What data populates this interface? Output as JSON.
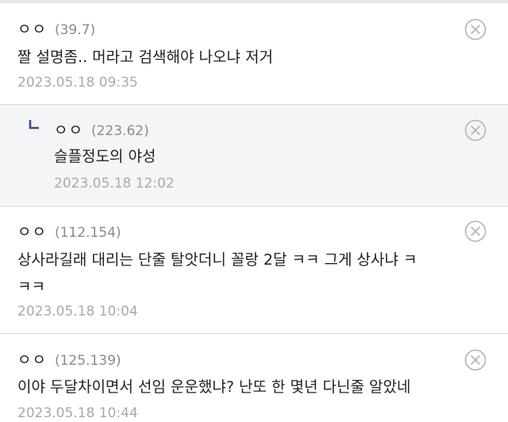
{
  "comments": [
    {
      "nick": "ㅇㅇ",
      "ip": "(39.7)",
      "text": "짤 설명좀.. 머라고 검색해야 나오냐 저거",
      "date": "2023.05.18 09:35"
    },
    {
      "nick": "ㅇㅇ",
      "ip": "(223.62)",
      "text": "슬플정도의 야성",
      "date": "2023.05.18 12:02"
    },
    {
      "nick": "ㅇㅇ",
      "ip": "(112.154)",
      "text_line1": "상사라길래 대리는 단줄 탈앗더니 꼴랑 2달 ㅋㅋ 그게 상사냐 ㅋ",
      "text_line2": "ㅋㅋ",
      "date": "2023.05.18 10:04"
    },
    {
      "nick": "ㅇㅇ",
      "ip": "(125.139)",
      "text": "이야 두달차이면서 선임 운운했냐? 난또 한 몇년 다닌줄 알았네",
      "date": "2023.05.18 10:44"
    }
  ]
}
